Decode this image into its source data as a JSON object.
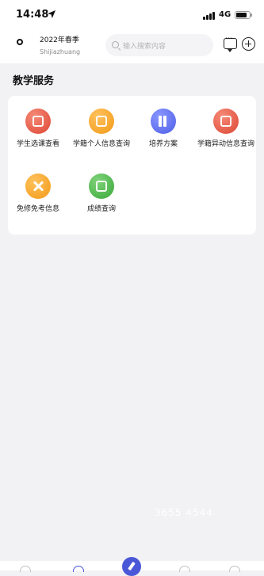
{
  "status_bar": {
    "time": "14:48",
    "network": "4G"
  },
  "header": {
    "term": "2022年春季",
    "city": "Shijiazhuang",
    "search_placeholder": "输入搜索内容"
  },
  "section": {
    "title": "教学服务",
    "items": [
      {
        "label": "学生选课查看",
        "icon": "calendar-icon",
        "color": "#e5533f"
      },
      {
        "label": "学籍个人信息查询",
        "icon": "id-card-icon",
        "color": "#f5a623"
      },
      {
        "label": "培养方案",
        "icon": "books-icon",
        "color": "#5b6cf0"
      },
      {
        "label": "学籍异动信息查询",
        "icon": "document-icon",
        "color": "#e5533f"
      },
      {
        "label": "免修免考信息",
        "icon": "cross-tools-icon",
        "color": "#f5a623"
      },
      {
        "label": "成绩查询",
        "icon": "grade-report-icon",
        "color": "#4cb84a"
      }
    ]
  },
  "watermark": "3655 4544",
  "colors": {
    "accent": "#4a58d8",
    "background": "#f2f2f4"
  }
}
